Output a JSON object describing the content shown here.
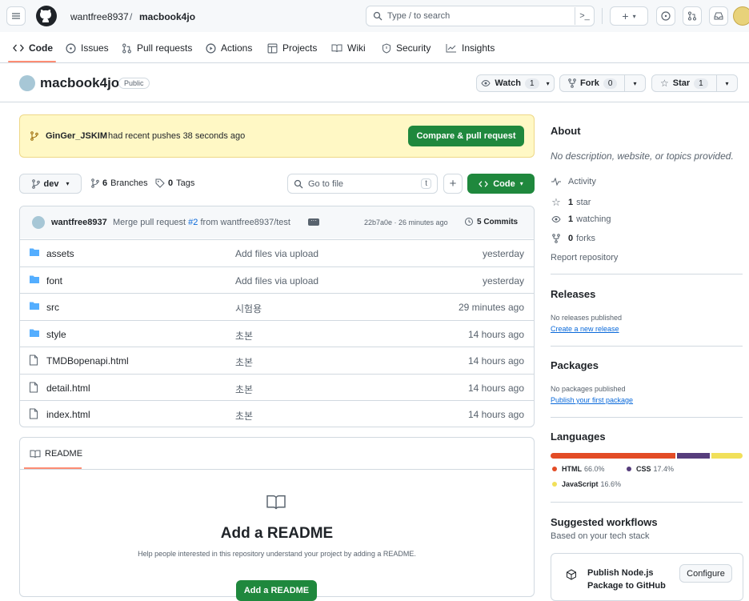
{
  "header": {
    "owner": "wantfree8937",
    "sep": "/",
    "repo": "macbook4jo",
    "search_placeholder": "Type / to search",
    "search_key": "/"
  },
  "tabs": [
    {
      "label": "Code",
      "icon": "code-icon"
    },
    {
      "label": "Issues",
      "icon": "issue-icon"
    },
    {
      "label": "Pull requests",
      "icon": "pull-request-icon"
    },
    {
      "label": "Actions",
      "icon": "play-icon"
    },
    {
      "label": "Projects",
      "icon": "table-icon"
    },
    {
      "label": "Wiki",
      "icon": "book-icon"
    },
    {
      "label": "Security",
      "icon": "shield-icon"
    },
    {
      "label": "Insights",
      "icon": "graph-icon"
    }
  ],
  "repo": {
    "name": "macbook4jo",
    "visibility": "Public",
    "watch": "Watch",
    "watch_count": "1",
    "fork": "Fork",
    "fork_count": "0",
    "star": "Star",
    "star_count": "1"
  },
  "banner": {
    "branch": "GinGer_JSKIM",
    "text": "had recent pushes 38 seconds ago",
    "button": "Compare & pull request"
  },
  "toolbar": {
    "branch": "dev",
    "branches_count": "6",
    "branches": "Branches",
    "tags_count": "0",
    "tags": "Tags",
    "goto": "Go to file",
    "goto_key": "t",
    "code": "Code"
  },
  "commit": {
    "author": "wantfree8937",
    "message_pre": "Merge pull request ",
    "pr": "#2",
    "message_post": " from wantfree8937/test",
    "meta": "22b7a0e · 26 minutes ago",
    "commits": "5 Commits"
  },
  "files": [
    {
      "type": "dir",
      "name": "assets",
      "msg": "Add files via upload",
      "date": "yesterday"
    },
    {
      "type": "dir",
      "name": "font",
      "msg": "Add files via upload",
      "date": "yesterday"
    },
    {
      "type": "dir",
      "name": "src",
      "msg": "시험용",
      "date": "29 minutes ago"
    },
    {
      "type": "dir",
      "name": "style",
      "msg": "초본",
      "date": "14 hours ago"
    },
    {
      "type": "file",
      "name": "TMDBopenapi.html",
      "msg": "초본",
      "date": "14 hours ago"
    },
    {
      "type": "file",
      "name": "detail.html",
      "msg": "초본",
      "date": "14 hours ago"
    },
    {
      "type": "file",
      "name": "index.html",
      "msg": "초본",
      "date": "14 hours ago"
    }
  ],
  "readme": {
    "tab": "README",
    "title": "Add a README",
    "desc": "Help people interested in this repository understand your project by adding a README.",
    "button": "Add a README"
  },
  "about": {
    "title": "About",
    "desc": "No description, website, or topics provided.",
    "activity": "Activity",
    "stars_n": "1",
    "stars": "star",
    "watching_n": "1",
    "watching": "watching",
    "forks_n": "0",
    "forks": "forks",
    "report": "Report repository"
  },
  "releases": {
    "title": "Releases",
    "none": "No releases published",
    "link": "Create a new release"
  },
  "packages": {
    "title": "Packages",
    "none": "No packages published",
    "link": "Publish your first package"
  },
  "languages": {
    "title": "Languages",
    "items": [
      {
        "name": "HTML",
        "pct": "66.0%",
        "value": 66.0,
        "color": "#e34c26"
      },
      {
        "name": "CSS",
        "pct": "17.4%",
        "value": 17.4,
        "color": "#563d7c"
      },
      {
        "name": "JavaScript",
        "pct": "16.6%",
        "value": 16.6,
        "color": "#f1e05a"
      }
    ]
  },
  "workflows": {
    "title": "Suggested workflows",
    "sub": "Based on your tech stack",
    "item": "Publish Node.js Package to GitHub",
    "item_l1": "Publish Node.js",
    "item_l2": "Package to GitHub",
    "button": "Configure"
  }
}
